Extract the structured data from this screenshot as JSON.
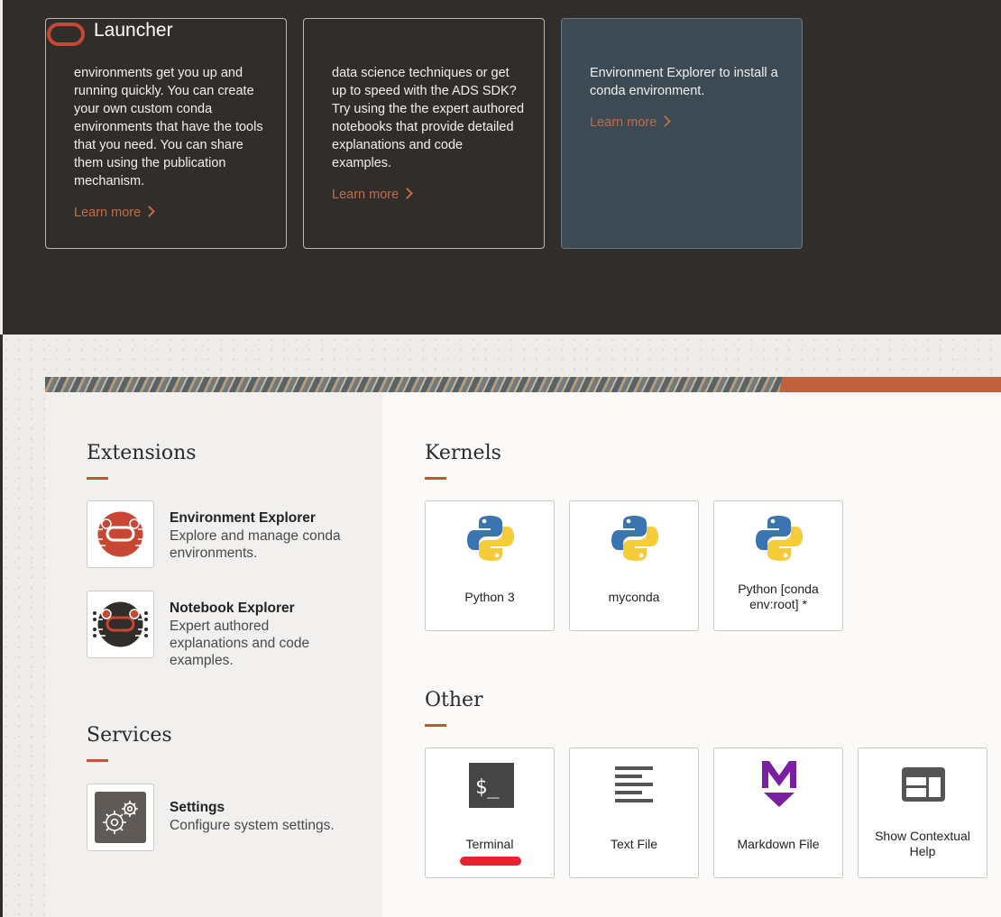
{
  "header": {
    "title": "Launcher"
  },
  "cards": [
    {
      "text": "environments get you up and running quickly. You can create your own custom conda environments that have the tools that you need. You can share them using the publication mechanism.",
      "link": "Learn more"
    },
    {
      "text": "data science techniques or get up to speed with the ADS SDK? Try using the the expert authored notebooks that provide detailed explanations and code examples.",
      "link": "Learn more"
    },
    {
      "text": "Environment Explorer to install a conda environment.",
      "link": "Learn more"
    }
  ],
  "extensions": {
    "title": "Extensions",
    "items": [
      {
        "name": "Environment Explorer",
        "desc": "Explore and manage conda environments.",
        "icon": "environment-explorer-icon"
      },
      {
        "name": "Notebook Explorer",
        "desc": "Expert authored explanations and code examples.",
        "icon": "notebook-explorer-icon"
      }
    ]
  },
  "services": {
    "title": "Services",
    "items": [
      {
        "name": "Settings",
        "desc": "Configure system settings.",
        "icon": "gears-icon"
      }
    ]
  },
  "kernels": {
    "title": "Kernels",
    "items": [
      {
        "label": "Python 3",
        "icon": "python-icon"
      },
      {
        "label": "myconda",
        "icon": "python-icon"
      },
      {
        "label": "Python [conda env:root] *",
        "icon": "python-icon"
      }
    ]
  },
  "other": {
    "title": "Other",
    "items": [
      {
        "label": "Terminal",
        "icon": "terminal-icon"
      },
      {
        "label": "Text File",
        "icon": "text-file-icon"
      },
      {
        "label": "Markdown File",
        "icon": "markdown-icon"
      },
      {
        "label": "Show Contextual Help",
        "icon": "contextual-help-icon"
      }
    ]
  },
  "colors": {
    "accent": "#c74634",
    "learn_more": "#c36b48",
    "dark_bg": "#312d2a",
    "card_highlight": "#3c4a54",
    "markdown": "#7b1fa2"
  }
}
